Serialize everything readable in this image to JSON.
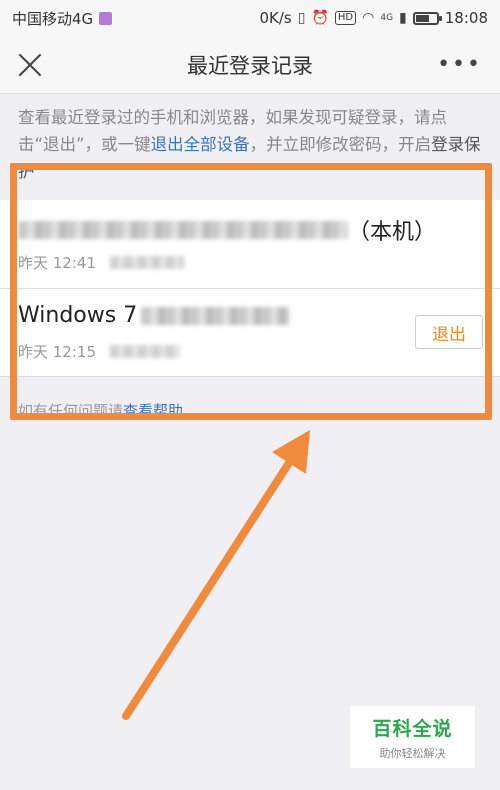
{
  "status_bar": {
    "carrier": "中国移动4G",
    "speed": "0K/s",
    "hd": "HD",
    "network": "4G",
    "time": "18:08",
    "battery_level": 0.6
  },
  "navbar": {
    "title": "最近登录记录",
    "more": "•••"
  },
  "notice": {
    "text_1": "查看最近登录过的手机和浏览器，如果发现可疑登录，请点击“退出”，或一键",
    "link": "退出全部设备",
    "text_2": "，并立即修改密码，开启",
    "strong": "登录保护"
  },
  "devices": [
    {
      "name_suffix": "（本机）",
      "time": "昨天 12:41"
    },
    {
      "name": "Windows 7",
      "time": "昨天 12:15",
      "button": "退出"
    }
  ],
  "help": {
    "text": "如有任何问题请",
    "link": "查看帮助"
  },
  "watermark": {
    "title": "百科全说",
    "subtitle": "助你轻松解决"
  },
  "colors": {
    "annotation": "#f08a3c",
    "link": "#3a74b8",
    "logout_text": "#f08a1e"
  }
}
